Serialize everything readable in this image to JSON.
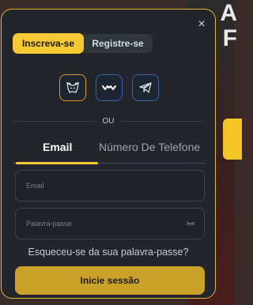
{
  "modal": {
    "tabs": [
      {
        "label": "Inscreva-se",
        "active": true
      },
      {
        "label": "Registre-se",
        "active": false
      }
    ],
    "social": [
      "metamask-icon",
      "walletconnect-icon",
      "telegram-icon"
    ],
    "or_label": "OU",
    "mode_tabs": {
      "email": "Email",
      "phone": "Número De Telefone"
    },
    "email_placeholder": "Email",
    "password_placeholder": "Palavra-passe",
    "forgot_label": "Esqueceu-se da sua palavra-passe?",
    "login_label": "Inicie sessão",
    "close_symbol": "×"
  },
  "background": {
    "letters": [
      "A",
      "F"
    ]
  },
  "colors": {
    "accent": "#f7c934",
    "modal_bg": "#22262c",
    "button_bg": "#caa22a"
  }
}
